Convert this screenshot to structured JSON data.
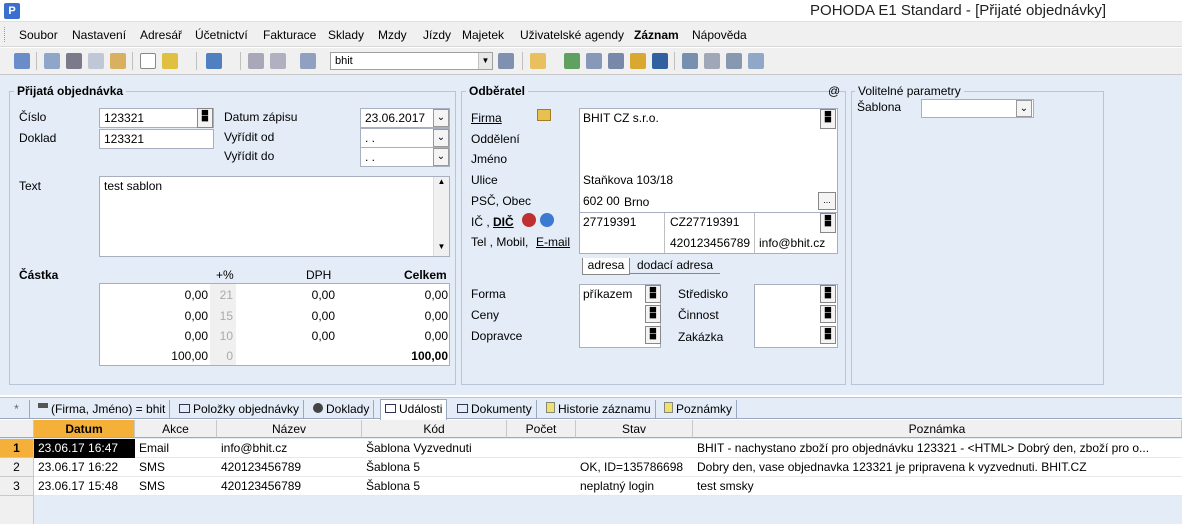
{
  "window": {
    "title": "POHODA E1 Standard - [Přijaté objednávky]",
    "icon": "pohoda-icon"
  },
  "menu": [
    "Soubor",
    "Nastavení",
    "Adresář",
    "Účetnictví",
    "Fakturace",
    "Sklady",
    "Mzdy",
    "Jízdy",
    "Majetek",
    "Uživatelské agendy",
    "Záznam",
    "Nápověda"
  ],
  "toolbar": {
    "filter_value": "bhit"
  },
  "order": {
    "group_title": "Přijatá objednávka",
    "cislo_label": "Číslo",
    "cislo_value": "123321",
    "doklad_label": "Doklad",
    "doklad_value": "123321",
    "datum_zapisu_label": "Datum zápisu",
    "datum_zapisu_value": "23.06.2017",
    "vyridit_od_label": "Vyřídit od",
    "vyridit_od_value": " .  .",
    "vyridit_do_label": "Vyřídit do",
    "vyridit_do_value": " .  .",
    "text_label": "Text",
    "text_value": "test sablon"
  },
  "amounts": {
    "castka_label": "Částka",
    "pct_label": "+%",
    "dph_label": "DPH",
    "celkem_label": "Celkem",
    "rows": [
      {
        "base": "0,00",
        "pct": "21",
        "dph": "0,00",
        "total": "0,00"
      },
      {
        "base": "0,00",
        "pct": "15",
        "dph": "0,00",
        "total": "0,00"
      },
      {
        "base": "0,00",
        "pct": "10",
        "dph": "0,00",
        "total": "0,00"
      },
      {
        "base": "100,00",
        "pct": "0",
        "dph": "",
        "total": "100,00"
      }
    ]
  },
  "customer": {
    "group_title": "Odběratel",
    "at_sign": "@",
    "firma_label": "Firma",
    "firma_value": "BHIT CZ s.r.o.",
    "oddeleni_label": "Oddělení",
    "jmeno_label": "Jméno",
    "ulice_label": "Ulice",
    "ulice_value": "Staňkova 103/18",
    "psc_label": "PSČ, Obec",
    "psc_value": "602 00",
    "obec_value": "Brno",
    "ic_label": "IČ ,",
    "dic_label": "DIČ",
    "ic_value": "27719391",
    "dic_value": "CZ27719391",
    "tel_label": "Tel , Mobil,",
    "email_label": "E-mail",
    "mobil_value": "420123456789",
    "email_value": "info@bhit.cz",
    "addr_tab": "adresa",
    "delivery_tab": "dodací adresa",
    "forma_label": "Forma",
    "forma_value": "příkazem",
    "ceny_label": "Ceny",
    "dopravce_label": "Dopravce",
    "stredisko_label": "Středisko",
    "cinnost_label": "Činnost",
    "zakazka_label": "Zakázka"
  },
  "params": {
    "group_title": "Volitelné parametry",
    "sablona_label": "Šablona"
  },
  "tabs": [
    {
      "label": "*"
    },
    {
      "label": "(Firma, Jméno) = bhit"
    },
    {
      "label": "Položky objednávky"
    },
    {
      "label": "Doklady"
    },
    {
      "label": "Události"
    },
    {
      "label": "Dokumenty"
    },
    {
      "label": "Historie záznamu"
    },
    {
      "label": "Poznámky"
    }
  ],
  "grid": {
    "headers": [
      "Datum",
      "Akce",
      "Název",
      "Kód",
      "Počet",
      "Stav",
      "Poznámka"
    ],
    "rows": [
      {
        "num": "1",
        "datum": "23.06.17 16:47",
        "akce": "Email",
        "nazev": "info@bhit.cz",
        "kod": "Šablona Vyzvednuti",
        "pocet": "",
        "stav": "",
        "poznamka": "BHIT - nachystano zboží pro objednávku 123321 - <HTML> Dobrý den, zboží pro o..."
      },
      {
        "num": "2",
        "datum": "23.06.17 16:22",
        "akce": "SMS",
        "nazev": "420123456789",
        "kod": "Šablona 5",
        "pocet": "",
        "stav": "OK, ID=135786698",
        "poznamka": "Dobry den, vase objednavka 123321 je pripravena k vyzvednuti. BHIT.CZ"
      },
      {
        "num": "3",
        "datum": "23.06.17 15:48",
        "akce": "SMS",
        "nazev": "420123456789",
        "kod": "Šablona 5",
        "pocet": "",
        "stav": "neplatný login",
        "poznamka": "test smsky"
      }
    ]
  }
}
